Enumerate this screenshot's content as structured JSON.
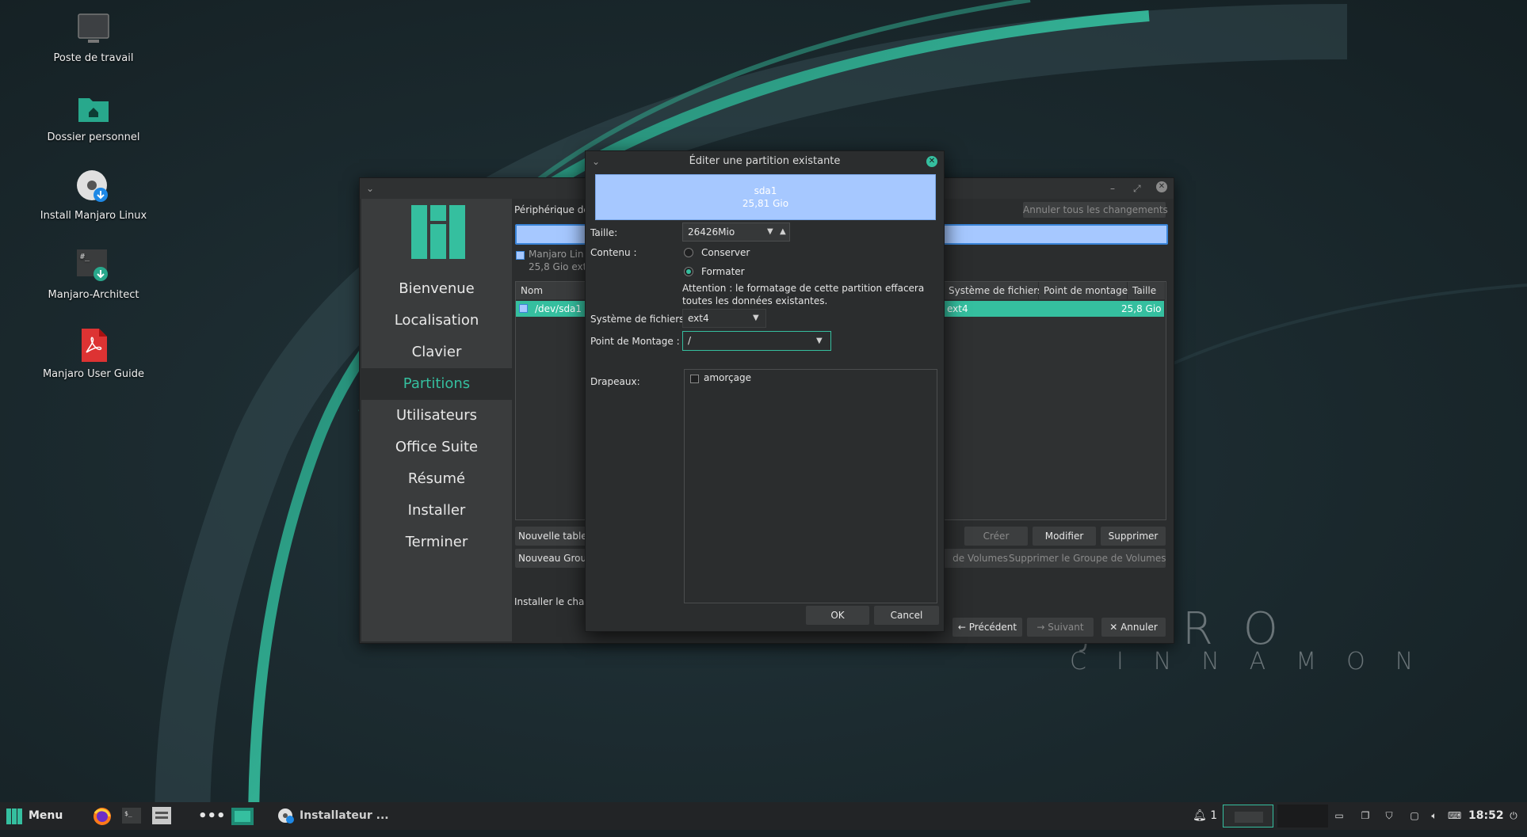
{
  "desktop": {
    "icons": [
      {
        "label": "Poste de travail"
      },
      {
        "label": "Dossier personnel"
      },
      {
        "label": "Install Manjaro Linux"
      },
      {
        "label": "Manjaro-Architect"
      },
      {
        "label": "Manjaro User Guide"
      }
    ],
    "watermark_line1": "JARO",
    "watermark_line2": "CINNAMON"
  },
  "installer": {
    "sidebar": [
      {
        "label": "Bienvenue"
      },
      {
        "label": "Localisation"
      },
      {
        "label": "Clavier"
      },
      {
        "label": "Partitions",
        "active": true
      },
      {
        "label": "Utilisateurs"
      },
      {
        "label": "Office Suite"
      },
      {
        "label": "Résumé"
      },
      {
        "label": "Installer"
      },
      {
        "label": "Terminer"
      }
    ],
    "device_label": "Périphérique de",
    "revert_all": "Annuler tous les changements",
    "disk_name": "Manjaro Lin",
    "disk_info": "25,8 Gio ext",
    "table_headers": {
      "name": "Nom",
      "filesystem": "Système de fichiers",
      "mountpoint": "Point de montage",
      "size": "Taille"
    },
    "row": {
      "name": "/dev/sda1",
      "filesystem": "ext4",
      "size": "25,8 Gio"
    },
    "buttons": {
      "new_table": "Nouvelle table",
      "create": "Créer",
      "edit": "Modifier",
      "delete": "Supprimer",
      "new_volume_group": "Nouveau Grou",
      "volumes_partial": "de Volumes",
      "delete_volume_group": "Supprimer le Groupe de Volumes"
    },
    "bootloader_label": "Installer le char",
    "nav": {
      "back": "Précédent",
      "next": "Suivant",
      "cancel": "Annuler"
    }
  },
  "dialog": {
    "title": "Éditer une partition existante",
    "partition_name": "sda1",
    "partition_size": "25,81 Gio",
    "size_label": "Taille:",
    "size_value": "26426Mio",
    "content_label": "Contenu :",
    "keep_label": "Conserver",
    "format_label": "Formater",
    "selected_content": "Formater",
    "warning_line1": "Attention : le formatage de cette partition effacera",
    "warning_line2": "toutes les données existantes.",
    "fs_label": "Système de fichiers:",
    "fs_value": "ext4",
    "mount_label": "Point de Montage :",
    "mount_value": "/",
    "flags_label": "Drapeaux:",
    "flags": [
      {
        "label": "amorçage",
        "checked": false
      }
    ],
    "ok": "OK",
    "cancel": "Cancel"
  },
  "taskbar": {
    "menu_label": "Menu",
    "window_label": "Installateur ...",
    "notifications_count": "1",
    "clock": "18:52"
  },
  "colors": {
    "accent": "#35bf9f",
    "partition_blue": "#a6c8ff",
    "panel": "#222426"
  }
}
